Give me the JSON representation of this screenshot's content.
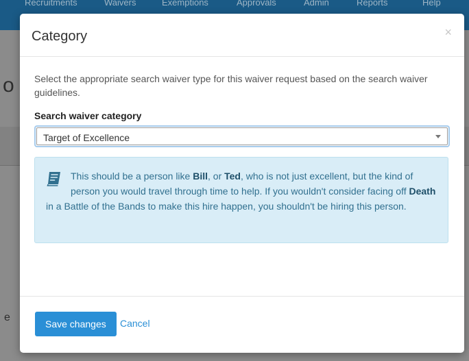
{
  "background": {
    "nav_items": [
      "Recruitments",
      "Waivers",
      "Exemptions",
      "Approvals",
      "Admin",
      "Reports",
      "Help"
    ],
    "glyph_top": "o",
    "glyph_bottom": "e"
  },
  "modal": {
    "title": "Category",
    "close_symbol": "×",
    "intro": "Select the appropriate search waiver type for this waiver request based on the search waiver guidelines.",
    "field_label": "Search waiver category",
    "select_value": "Target of Excellence",
    "callout": {
      "icon": "book-icon",
      "segments": [
        {
          "text": "This should be a person like ",
          "bold": false
        },
        {
          "text": "Bill",
          "bold": true
        },
        {
          "text": ", or ",
          "bold": false
        },
        {
          "text": "Ted",
          "bold": true
        },
        {
          "text": ", who is not just excellent, but the kind of person you would travel through time to help. If you wouldn't consider facing off ",
          "bold": false
        },
        {
          "text": "Death",
          "bold": true
        },
        {
          "text": " in a Battle of the Bands to make this hire happen, you shouldn't be hiring this person.",
          "bold": false
        }
      ]
    },
    "save_label": "Save changes",
    "cancel_label": "Cancel"
  },
  "colors": {
    "primary": "#2a8fd6",
    "info_bg": "#d9edf7",
    "info_text": "#31708f",
    "nav_bg": "#1a5a86"
  }
}
